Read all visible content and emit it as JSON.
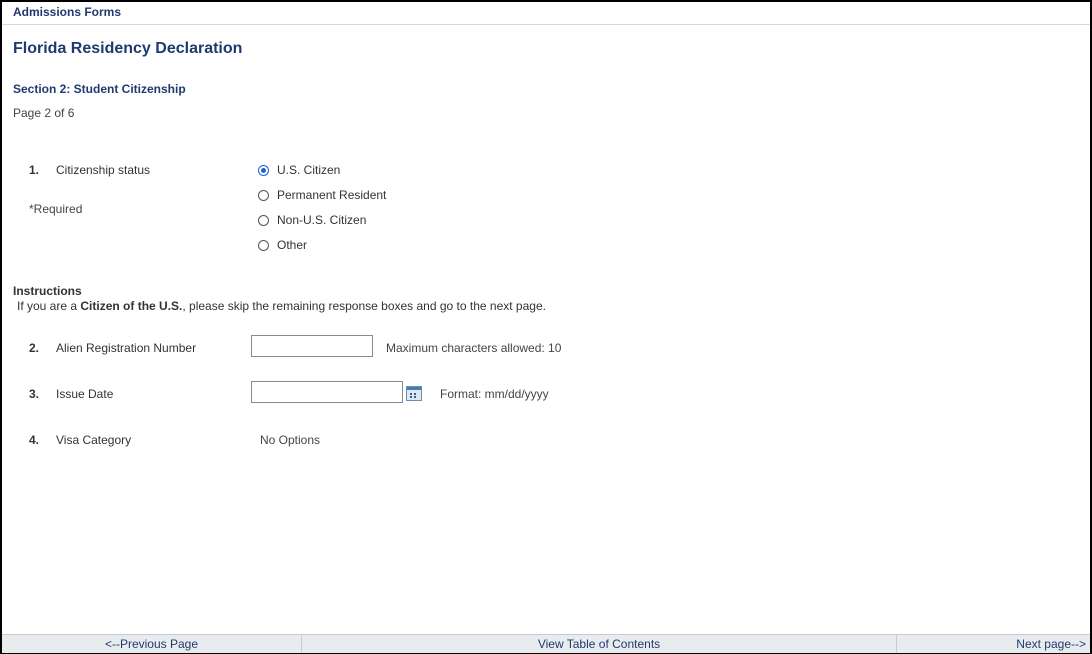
{
  "breadcrumb": "Admissions Forms",
  "page_title": "Florida Residency Declaration",
  "section_title": "Section 2: Student Citizenship",
  "page_indicator": "Page 2 of 6",
  "questions": [
    {
      "number": "1.",
      "label": "Citizenship status",
      "required_note": "*Required",
      "options": [
        {
          "label": "U.S. Citizen",
          "checked": true
        },
        {
          "label": "Permanent Resident",
          "checked": false
        },
        {
          "label": "Non-U.S. Citizen",
          "checked": false
        },
        {
          "label": "Other",
          "checked": false
        }
      ]
    },
    {
      "number": "2.",
      "label": "Alien Registration Number",
      "value": "",
      "hint": "Maximum characters allowed: 10"
    },
    {
      "number": "3.",
      "label": "Issue Date",
      "value": "",
      "hint": "Format: mm/dd/yyyy",
      "icon": "calendar-icon"
    },
    {
      "number": "4.",
      "label": "Visa Category",
      "value_text": "No Options"
    }
  ],
  "instructions": {
    "heading": "Instructions",
    "text_before": "If you are a ",
    "text_bold": "Citizen of the U.S.",
    "text_after": ", please skip the remaining response boxes and go to the next page."
  },
  "footer": {
    "prev": "<--Previous Page",
    "toc": "View Table of Contents",
    "next": "Next page-->"
  },
  "colors": {
    "heading_blue": "#1f3a6e",
    "radio_selected": "#1a66d1",
    "footer_bg": "#e9ecef"
  }
}
